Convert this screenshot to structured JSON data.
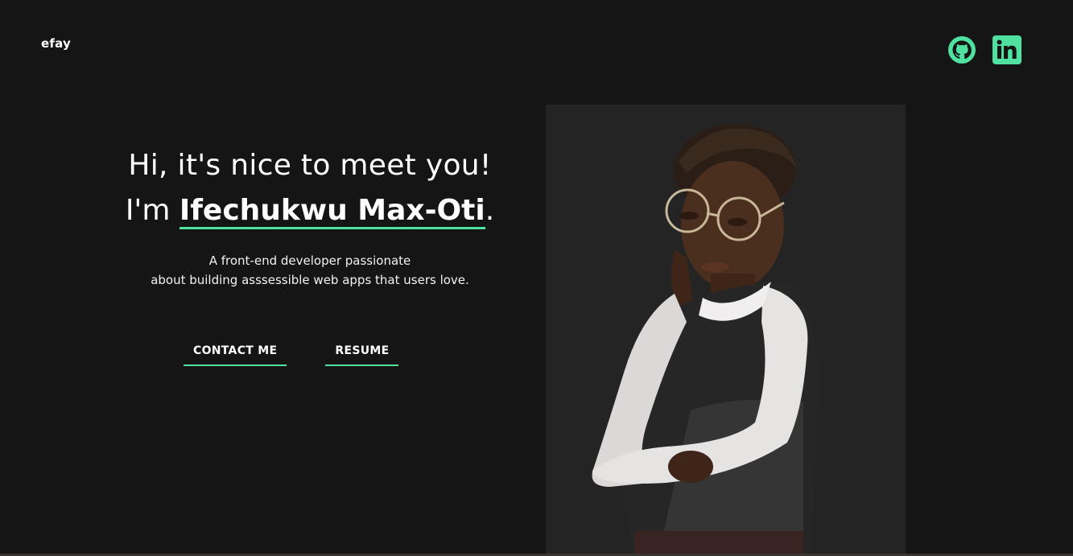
{
  "header": {
    "logo": "efay",
    "social": [
      {
        "name": "github-icon",
        "color": "#4ee1a0"
      },
      {
        "name": "linkedin-icon",
        "color": "#4ee1a0"
      }
    ]
  },
  "hero": {
    "greeting": "Hi, it's nice to meet you!",
    "name_prefix": "I'm ",
    "name": "Ifechukwu Max-Oti",
    "name_suffix": ".",
    "tagline_line1": "A front-end developer passionate",
    "tagline_line2": "about building asssessible web apps that users love.",
    "contact_label": "CONTACT ME",
    "resume_label": "RESUME"
  },
  "theme": {
    "background": "#151515",
    "accent": "#4ee1a0",
    "photo_background": "#242424"
  }
}
